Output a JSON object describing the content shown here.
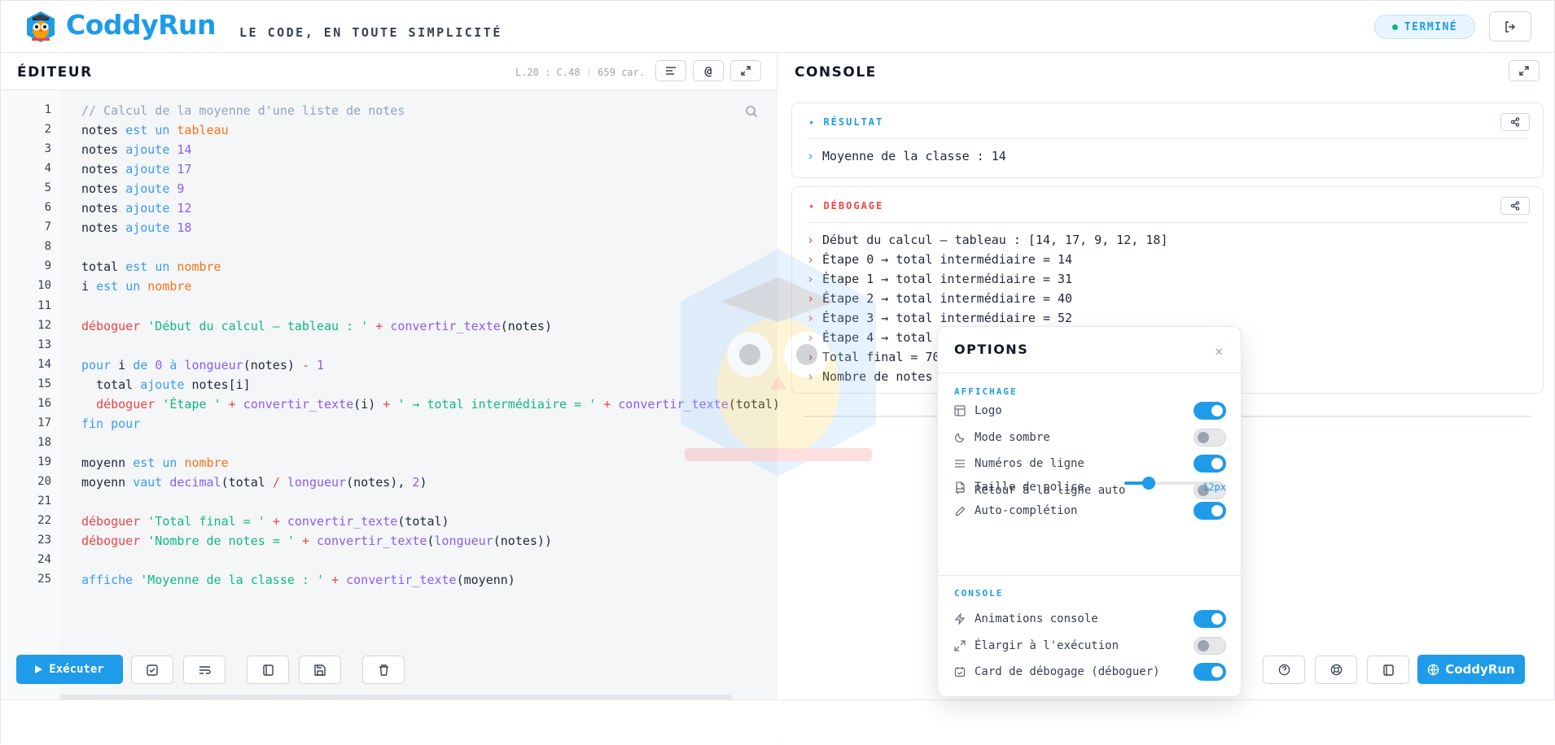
{
  "header": {
    "brand": "CoddyRun",
    "tagline": "LE CODE, EN TOUTE SIMPLICITÉ",
    "status": "TERMINÉ"
  },
  "editor": {
    "title": "ÉDITEUR",
    "position": "L.20 : C.48",
    "chars": "659 car.",
    "line_numbers": [
      "1",
      "2",
      "3",
      "4",
      "5",
      "6",
      "7",
      "8",
      "9",
      "10",
      "11",
      "12",
      "13",
      "14",
      "15",
      "16",
      "17",
      "18",
      "19",
      "20",
      "21",
      "22",
      "23",
      "24",
      "25"
    ],
    "code": [
      "// Calcul de la moyenne d'une liste de notes",
      "notes est un tableau",
      "notes ajoute 14",
      "notes ajoute 17",
      "notes ajoute 9",
      "notes ajoute 12",
      "notes ajoute 18",
      "",
      "total est un nombre",
      "i est un nombre",
      "",
      "déboguer 'Début du calcul — tableau : ' + convertir_texte(notes)",
      "",
      "pour i de 0 à longueur(notes) - 1",
      "  total ajoute notes[i]",
      "  déboguer 'Étape ' + convertir_texte(i) + ' → total intermédiaire = ' + convertir_texte(total)",
      "fin pour",
      "",
      "moyenn est un nombre",
      "moyenn vaut decimal(total / longueur(notes), 2)",
      "",
      "déboguer 'Total final = ' + convertir_texte(total)",
      "déboguer 'Nombre de notes = ' + convertir_texte(longueur(notes))",
      "",
      "affiche 'Moyenne de la classe : ' + convertir_texte(moyenn)"
    ],
    "run_label": "Exécuter"
  },
  "console": {
    "title": "CONSOLE",
    "result_title": "RÉSULTAT",
    "result_lines": [
      "Moyenne de la classe : 14"
    ],
    "debug_title": "DÉBOGAGE",
    "debug_lines": [
      "Début du calcul — tableau : [14, 17, 9, 12, 18]",
      "Étape 0 → total intermédiaire = 14",
      "Étape 1 → total intermédiaire = 31",
      "Étape 2 → total intermédiaire = 40",
      "Étape 3 → total intermédiaire = 52",
      "Étape 4 → total",
      "Total final = 70",
      "Nombre de notes"
    ],
    "brand_button": "CoddyRun"
  },
  "options": {
    "title": "OPTIONS",
    "display_section": "AFFICHAGE",
    "console_section": "CONSOLE",
    "display": [
      {
        "label": "Logo",
        "on": true,
        "icon": "layout-icon"
      },
      {
        "label": "Mode sombre",
        "on": false,
        "icon": "moon-icon"
      },
      {
        "label": "Numéros de ligne",
        "on": true,
        "icon": "list-icon"
      },
      {
        "label": "Retour à la ligne auto",
        "on": false,
        "icon": "wrap-icon"
      }
    ],
    "font_size_label": "Taille de police",
    "font_size_value": "12px",
    "font_size_fraction": 0.3,
    "autocomplete": {
      "label": "Auto-complétion",
      "on": true
    },
    "console": [
      {
        "label": "Animations console",
        "on": true,
        "icon": "zap-icon"
      },
      {
        "label": "Élargir à l'exécution",
        "on": false,
        "icon": "expand-icon"
      },
      {
        "label": "Card de débogage (déboguer)",
        "on": true,
        "icon": "calendar-check-icon"
      }
    ]
  },
  "colors": {
    "accent": "#1e9be9",
    "debug": "#ef4444",
    "keyword": "#3b9bf5",
    "type": "#f97316",
    "number": "#8b5cf6",
    "string": "#10b981"
  }
}
